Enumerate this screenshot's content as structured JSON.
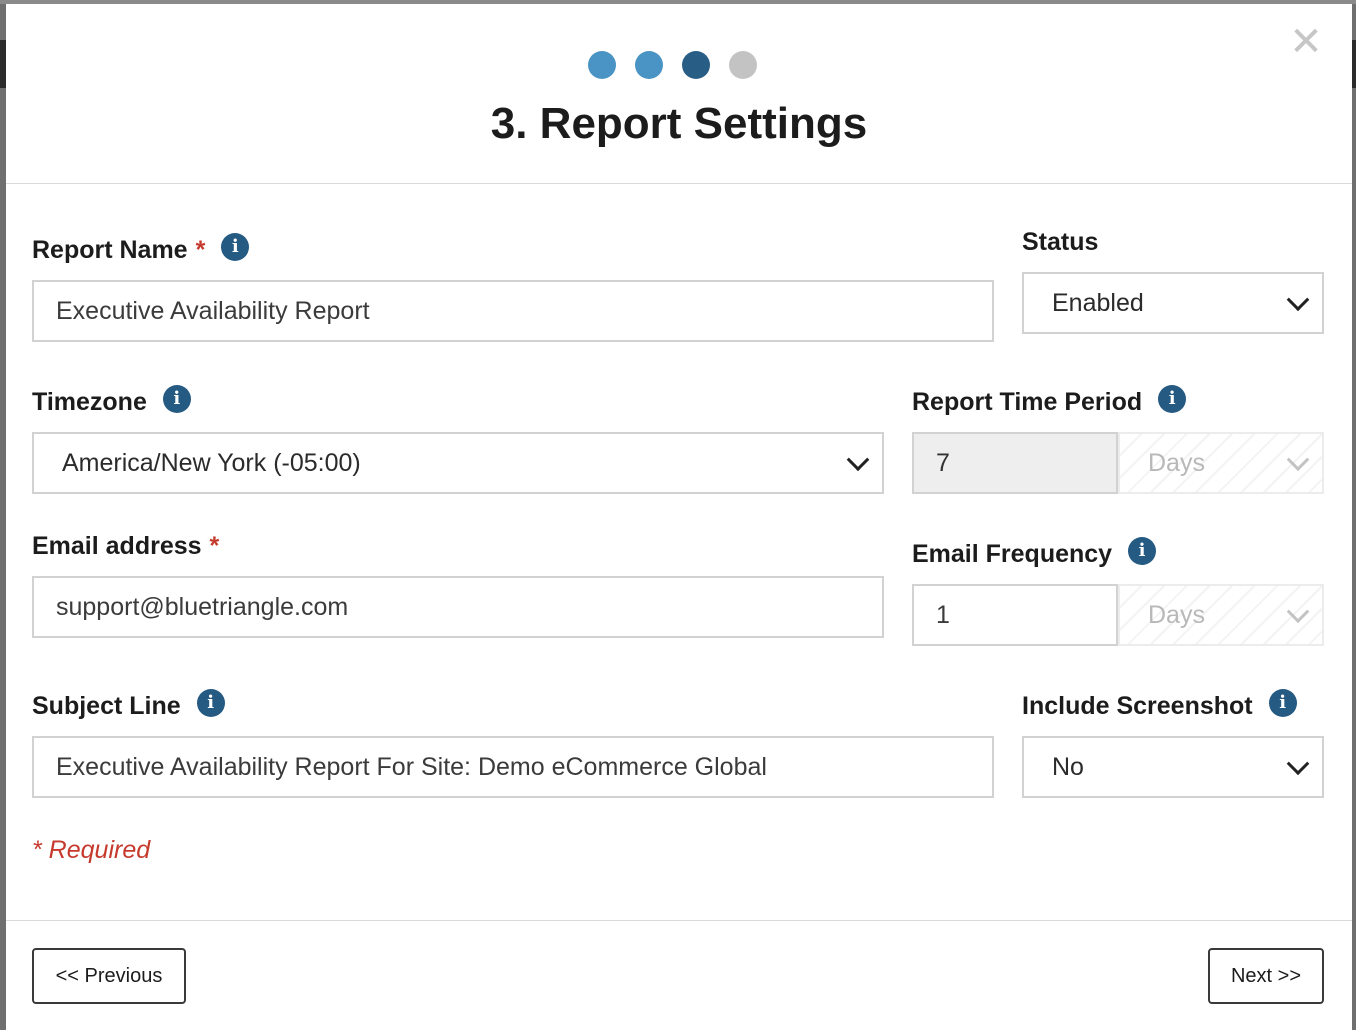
{
  "wizard": {
    "steps": [
      {
        "state": "done"
      },
      {
        "state": "done"
      },
      {
        "state": "current"
      },
      {
        "state": "todo"
      }
    ],
    "title": "3. Report Settings",
    "close_icon": "close-icon"
  },
  "form": {
    "report_name": {
      "label": "Report Name",
      "required_mark": "*",
      "value": "Executive Availability Report"
    },
    "status": {
      "label": "Status",
      "selected": "Enabled"
    },
    "timezone": {
      "label": "Timezone",
      "selected": "America/New York (-05:00)"
    },
    "report_time_period": {
      "label": "Report Time Period",
      "value": "7",
      "unit": "Days"
    },
    "email_address": {
      "label": "Email address",
      "required_mark": "*",
      "value": "support@bluetriangle.com"
    },
    "email_frequency": {
      "label": "Email Frequency",
      "value": "1",
      "unit": "Days"
    },
    "subject_line": {
      "label": "Subject Line",
      "value": "Executive Availability Report For Site: Demo eCommerce Global"
    },
    "include_screenshot": {
      "label": "Include Screenshot",
      "selected": "No"
    },
    "required_note": "* Required",
    "info_glyph": "i"
  },
  "footer": {
    "previous_label": "<< Previous",
    "next_label": "Next >>"
  },
  "colors": {
    "accent": "#255a82",
    "step_done": "#4994c4",
    "step_current": "#285e85",
    "step_todo": "#c3c3c3",
    "required": "#c63a2e"
  }
}
